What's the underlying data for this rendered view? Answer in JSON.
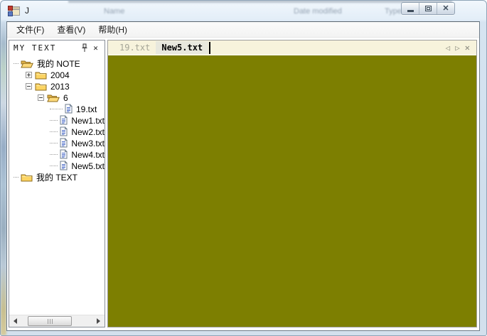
{
  "window": {
    "title": "J",
    "ghost_text": {
      "name": "Name",
      "date_modified": "Date modified",
      "type": "Type"
    }
  },
  "menubar": {
    "items": [
      {
        "label": "文件(F)"
      },
      {
        "label": "查看(V)"
      },
      {
        "label": "帮助(H)"
      }
    ]
  },
  "sidebar": {
    "title": "MY TEXT",
    "tree": [
      {
        "label": "我的 NOTE",
        "level": 0,
        "icon": "folder-open",
        "expander": "none"
      },
      {
        "label": "2004",
        "level": 1,
        "icon": "folder-closed",
        "expander": "plus"
      },
      {
        "label": "2013",
        "level": 1,
        "icon": "folder-closed",
        "expander": "minus"
      },
      {
        "label": "6",
        "level": 2,
        "icon": "folder-open",
        "expander": "minus"
      },
      {
        "label": "19.txt",
        "level": 3,
        "icon": "document",
        "expander": "none"
      },
      {
        "label": "New1.txt",
        "level": 3,
        "icon": "document",
        "expander": "none"
      },
      {
        "label": "New2.txt",
        "level": 3,
        "icon": "document",
        "expander": "none"
      },
      {
        "label": "New3.txt",
        "level": 3,
        "icon": "document",
        "expander": "none"
      },
      {
        "label": "New4.txt",
        "level": 3,
        "icon": "document",
        "expander": "none"
      },
      {
        "label": "New5.txt",
        "level": 3,
        "icon": "document",
        "expander": "none"
      },
      {
        "label": "我的 TEXT",
        "level": 0,
        "icon": "folder-closed",
        "expander": "none"
      }
    ]
  },
  "tabbar": {
    "tabs": [
      {
        "label": "19.txt",
        "active": false
      },
      {
        "label": "New5.txt",
        "active": true
      }
    ]
  },
  "icons": [
    "app-icon",
    "pin-icon",
    "close-icon",
    "minimize-icon",
    "maximize-icon",
    "folder-open-icon",
    "folder-closed-icon",
    "document-icon",
    "tab-prev-icon",
    "tab-next-icon",
    "scroll-left-icon",
    "scroll-right-icon"
  ],
  "colors": {
    "editor_bg": "#7d7f01",
    "tabbar_bg": "#f7f3dc",
    "active_tab_bg": "#e8e8de",
    "titlebar_glass": "#dde9f4",
    "folder_yellow": "#fcd462"
  }
}
